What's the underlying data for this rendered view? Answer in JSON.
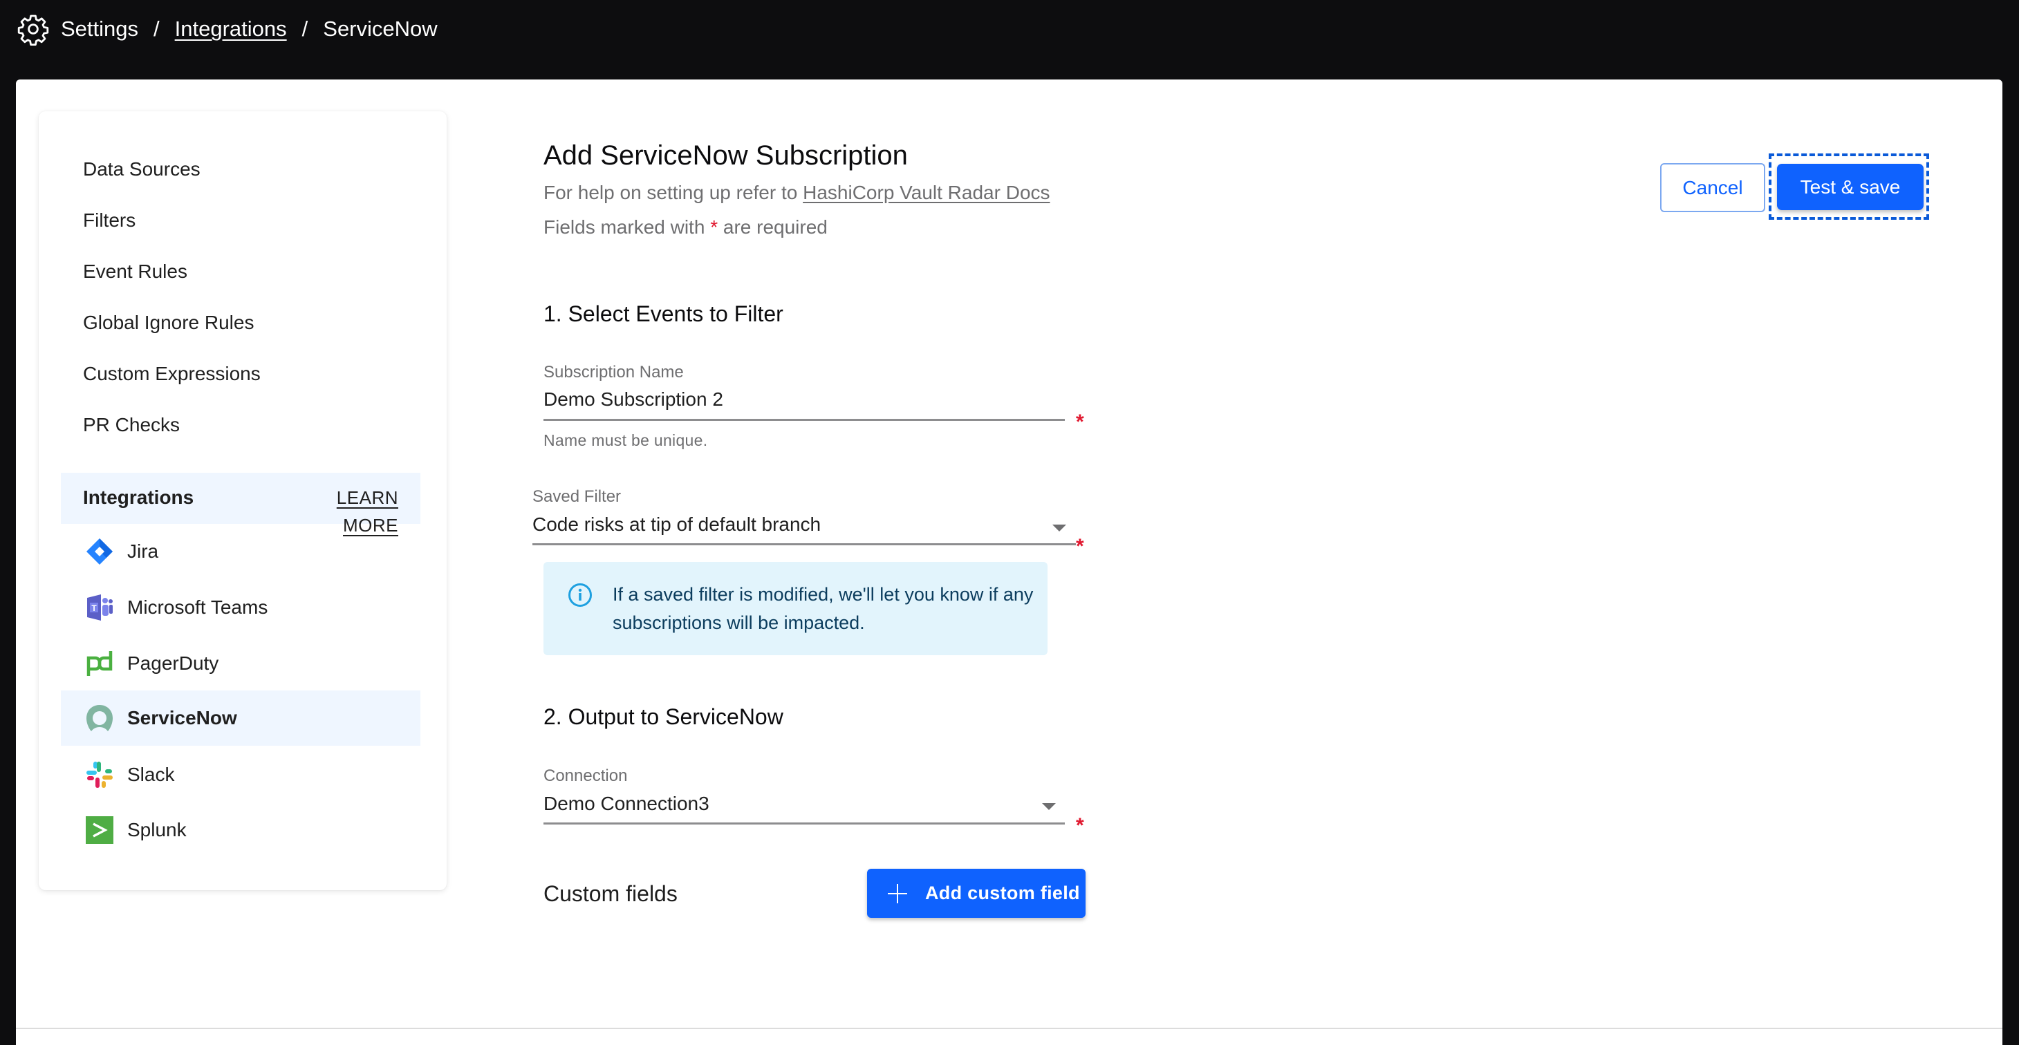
{
  "breadcrumb": {
    "icon": "gear-icon",
    "items": [
      {
        "label": "Settings",
        "link": false
      },
      {
        "label": "Integrations",
        "link": true
      },
      {
        "label": "ServiceNow",
        "link": false
      }
    ],
    "separator": "/"
  },
  "sidebar": {
    "items": [
      {
        "label": "Data Sources"
      },
      {
        "label": "Filters"
      },
      {
        "label": "Event Rules"
      },
      {
        "label": "Global Ignore Rules"
      },
      {
        "label": "Custom Expressions"
      },
      {
        "label": "PR Checks"
      }
    ],
    "integrations": {
      "title": "Integrations",
      "learn_more": "LEARN MORE",
      "items": [
        {
          "label": "Jira",
          "icon": "jira-icon",
          "active": false
        },
        {
          "label": "Microsoft Teams",
          "icon": "microsoft-teams-icon",
          "active": false
        },
        {
          "label": "PagerDuty",
          "icon": "pagerduty-icon",
          "active": false
        },
        {
          "label": "ServiceNow",
          "icon": "servicenow-icon",
          "active": true
        },
        {
          "label": "Slack",
          "icon": "slack-icon",
          "active": false
        },
        {
          "label": "Splunk",
          "icon": "splunk-icon",
          "active": false
        }
      ]
    }
  },
  "form": {
    "title": "Add ServiceNow Subscription",
    "help_prefix": "For help on setting up refer to ",
    "help_link": "HashiCorp Vault Radar Docs",
    "required_prefix": "Fields marked with ",
    "required_star": "*",
    "required_suffix": " are required",
    "section1": "1. Select Events to Filter",
    "subscription_name": {
      "label": "Subscription Name",
      "value": "Demo Subscription 2",
      "helper": "Name must be unique.",
      "required": "*"
    },
    "saved_filter": {
      "label": "Saved Filter",
      "value": "Code risks at tip of default branch",
      "required": "*"
    },
    "info_message": "If a saved filter is modified, we'll let you know if any subscriptions will be impacted.",
    "section2": "2. Output to ServiceNow",
    "connection": {
      "label": "Connection",
      "value": "Demo Connection3",
      "required": "*"
    },
    "custom_fields_label": "Custom fields",
    "add_custom_field": "Add custom field"
  },
  "actions": {
    "cancel": "Cancel",
    "test_save": "Test & save"
  },
  "colors": {
    "primary": "#0f62fe",
    "required": "#e0182f",
    "info_bg": "#e2f4fc",
    "active_bg": "#eff6ff",
    "header_bg": "#0d0d0f"
  }
}
